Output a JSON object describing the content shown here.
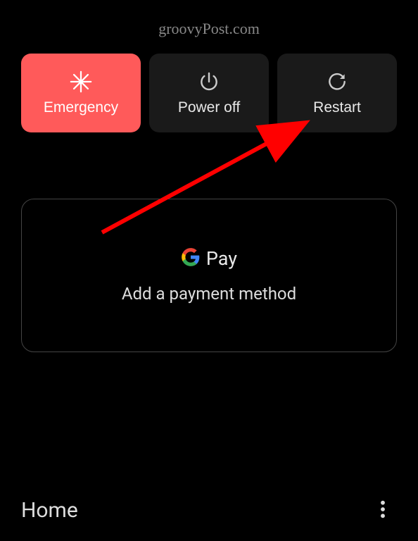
{
  "watermark": "groovyPost.com",
  "power_menu": {
    "emergency": {
      "label": "Emergency"
    },
    "power_off": {
      "label": "Power off"
    },
    "restart": {
      "label": "Restart"
    }
  },
  "gpay": {
    "brand": "Pay",
    "subtitle": "Add a payment method"
  },
  "bottom": {
    "home": "Home"
  }
}
